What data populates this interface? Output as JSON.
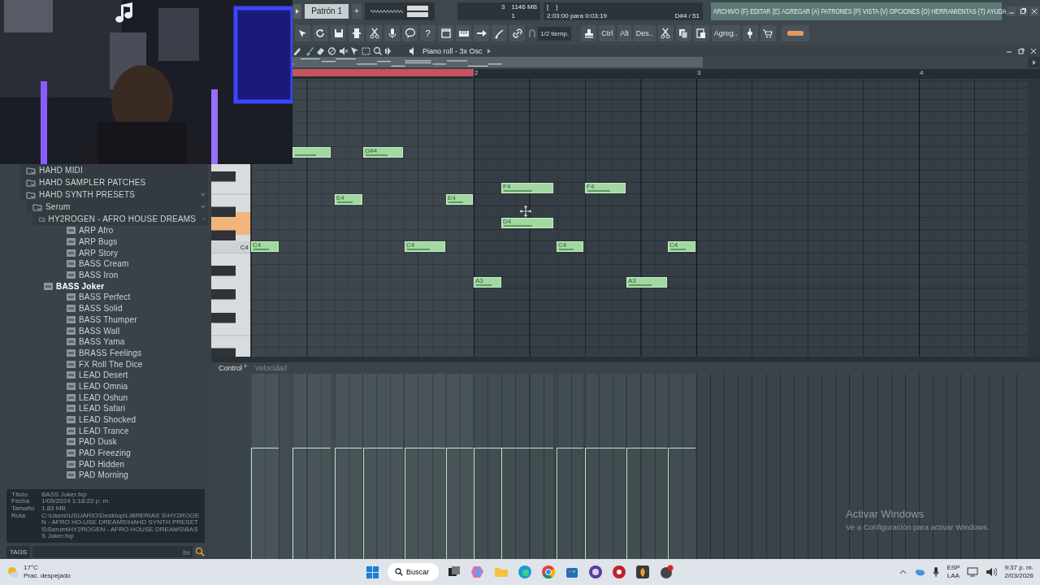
{
  "toolbar": {
    "pattern": "Patrón 1",
    "add_pattern": "+",
    "cpu_value": "3",
    "memory": "1146 MB",
    "polyphony": "1",
    "hint_brackets": "[    ]",
    "time_hint": "2:03:00 para 0:03:19",
    "note_info": "D#4 / 51",
    "menu": [
      "ARCHIVO (F)",
      "EDITAR (E)",
      "AGREGAR (A)",
      "PATRONES (P)",
      "VISTA (V)",
      "OPCIONES (O)",
      "HERRAMIENTAS (T)",
      "AYUDA"
    ],
    "help_label": "?",
    "snap": "1/2 tiemp.",
    "keys": [
      "Ctrl",
      "Alt",
      "Des.."
    ],
    "add_label": "Agreg.."
  },
  "piano_roll": {
    "title": "Piano roll - 3x Osc",
    "timeline": {
      "markers": [
        "2",
        "3",
        "4"
      ],
      "loop_region": true
    },
    "keyboard": {
      "label": "C4",
      "key_highlighted": true
    },
    "notes": [
      {
        "label": "C4",
        "level": 0.6
      },
      {
        "level": 0.6
      },
      {
        "label": "E4",
        "level": 0.6
      },
      {
        "label": "G#4",
        "level": 0.6
      },
      {
        "label": "C4",
        "level": 0.6
      },
      {
        "label": "E4",
        "level": 0.6
      },
      {
        "label": "A3",
        "level": 0.6
      },
      {
        "label": "F4",
        "level": 0.6
      },
      {
        "label": "D4",
        "level": 0.6
      },
      {
        "label": "C4",
        "level": 0.6
      },
      {
        "label": "F4",
        "level": 0.6
      },
      {
        "label": "A3",
        "level": 0.6
      },
      {
        "label": "C4",
        "level": 0.6
      }
    ],
    "control": {
      "label": "Control",
      "lane": "Velocidad"
    }
  },
  "browser": {
    "tree": [
      {
        "label": "HAHD MIDI",
        "expanded": false
      },
      {
        "label": "HAHD SAMPLER PATCHES",
        "expanded": false
      },
      {
        "label": "HAHD SYNTH PRESETS",
        "expanded": true,
        "children": [
          {
            "label": "Serum",
            "expanded": true,
            "children": [
              {
                "label": "HY2ROGEN - AFRO HOUSE DREAMS",
                "expanded": true,
                "children": [
                  {
                    "label": "ARP Afro",
                    "selected": false
                  },
                  {
                    "label": "ARP Bugs",
                    "selected": false
                  },
                  {
                    "label": "ARP Story",
                    "selected": false
                  },
                  {
                    "label": "BASS Cream",
                    "selected": false
                  },
                  {
                    "label": "BASS Iron",
                    "selected": false
                  },
                  {
                    "label": "BASS Joker",
                    "selected": true
                  },
                  {
                    "label": "BASS Perfect",
                    "selected": false
                  },
                  {
                    "label": "BASS Solid",
                    "selected": false
                  },
                  {
                    "label": "BASS Thumper",
                    "selected": false
                  },
                  {
                    "label": "BASS Wall",
                    "selected": false
                  },
                  {
                    "label": "BASS Yama",
                    "selected": false
                  },
                  {
                    "label": "BRASS Feelings",
                    "selected": false
                  },
                  {
                    "label": "FX Roll The Dice",
                    "selected": false
                  },
                  {
                    "label": "LEAD Desert",
                    "selected": false
                  },
                  {
                    "label": "LEAD Omnia",
                    "selected": false
                  },
                  {
                    "label": "LEAD Oshun",
                    "selected": false
                  },
                  {
                    "label": "LEAD Safari",
                    "selected": false
                  },
                  {
                    "label": "LEAD Shocked",
                    "selected": false
                  },
                  {
                    "label": "LEAD Trance",
                    "selected": false
                  },
                  {
                    "label": "PAD Dusk",
                    "selected": false
                  },
                  {
                    "label": "PAD Freezing",
                    "selected": false
                  },
                  {
                    "label": "PAD Hidden",
                    "selected": false
                  },
                  {
                    "label": "PAD Morning",
                    "selected": false
                  }
                ]
              }
            ]
          }
        ]
      }
    ],
    "info": [
      {
        "key": "Título",
        "value": "BASS Joker.fxp"
      },
      {
        "key": "Fecha",
        "value": "1/09/2024 1:18:22 p. m."
      },
      {
        "key": "Tamaño",
        "value": "1.83 MB"
      },
      {
        "key": "Ruta",
        "value": "C:\\Users\\USUARIO\\Desktop\\LIBRERIAS S\\HY2ROGEN - AFRO HO-USE DREAMS\\HAHD SYNTH PRESETS\\Serum\\HY2ROGEN - AFRO HOUSE DREAMS\\BASS Joker.fxp"
      }
    ],
    "tags_label": "TAGS"
  },
  "activation": {
    "title": "Activar Windows",
    "text": "Ve a Configuración para activar Windows."
  },
  "taskbar": {
    "temperature": "17°C",
    "weather": "Prac. despejado",
    "search": "Buscar",
    "language": "ESP",
    "region": "LAA",
    "time": "9:37 p. m.",
    "date": "2/03/2026"
  }
}
